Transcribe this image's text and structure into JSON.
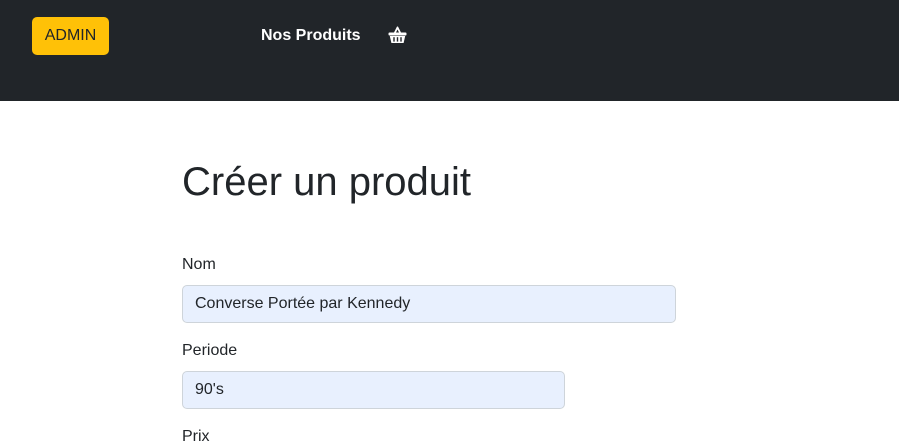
{
  "navbar": {
    "admin_label": "ADMIN",
    "nav_link_label": "Nos Produits",
    "cart_icon": "shopping-basket-icon",
    "background_color": "#212529",
    "admin_color": "#ffc107"
  },
  "main": {
    "title": "Créer un produit",
    "fields": {
      "nom": {
        "label": "Nom",
        "value": "Converse Portée par Kennedy"
      },
      "periode": {
        "label": "Periode",
        "value": "90's"
      },
      "prix": {
        "label": "Prix"
      }
    },
    "input_fill_color": "#e8f0fe"
  }
}
